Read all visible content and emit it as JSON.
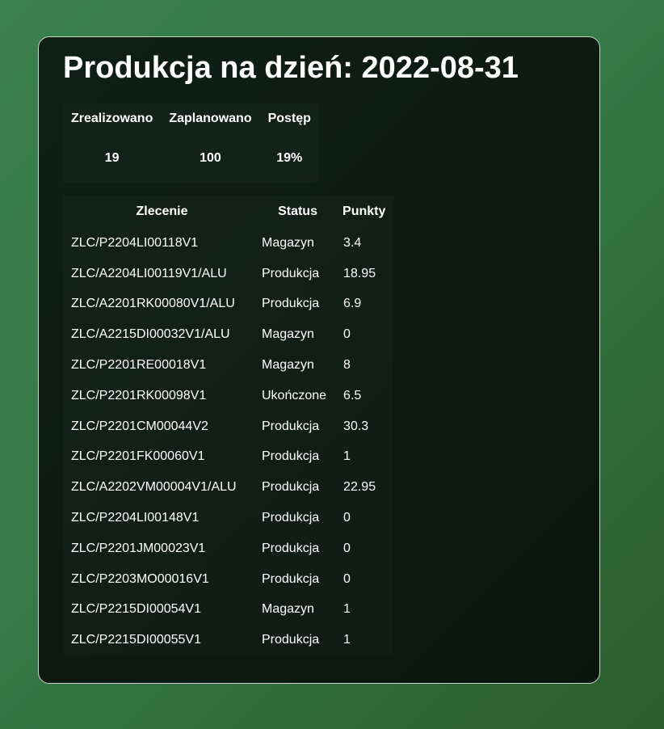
{
  "title": "Produkcja na dzień: 2022-08-31",
  "summary": {
    "headers": [
      "Zrealizowano",
      "Zaplanowano",
      "Postęp"
    ],
    "values": [
      "19",
      "100",
      "19%"
    ]
  },
  "orders": {
    "headers": [
      "Zlecenie",
      "Status",
      "Punkty"
    ],
    "rows": [
      [
        "ZLC/P2204LI00118V1",
        "Magazyn",
        "3.4"
      ],
      [
        "ZLC/A2204LI00119V1/ALU",
        "Produkcja",
        "18.95"
      ],
      [
        "ZLC/A2201RK00080V1/ALU",
        "Produkcja",
        "6.9"
      ],
      [
        "ZLC/A2215DI00032V1/ALU",
        "Magazyn",
        "0"
      ],
      [
        "ZLC/P2201RE00018V1",
        "Magazyn",
        "8"
      ],
      [
        "ZLC/P2201RK00098V1",
        "Ukończone",
        "6.5"
      ],
      [
        "ZLC/P2201CM00044V2",
        "Produkcja",
        "30.3"
      ],
      [
        "ZLC/P2201FK00060V1",
        "Produkcja",
        "1"
      ],
      [
        "ZLC/A2202VM00004V1/ALU",
        "Produkcja",
        "22.95"
      ],
      [
        "ZLC/P2204LI00148V1",
        "Produkcja",
        "0"
      ],
      [
        "ZLC/P2201JM00023V1",
        "Produkcja",
        "0"
      ],
      [
        "ZLC/P2203MO00016V1",
        "Produkcja",
        "0"
      ],
      [
        "ZLC/P2215DI00054V1",
        "Magazyn",
        "1"
      ],
      [
        "ZLC/P2215DI00055V1",
        "Produkcja",
        "1"
      ]
    ]
  }
}
